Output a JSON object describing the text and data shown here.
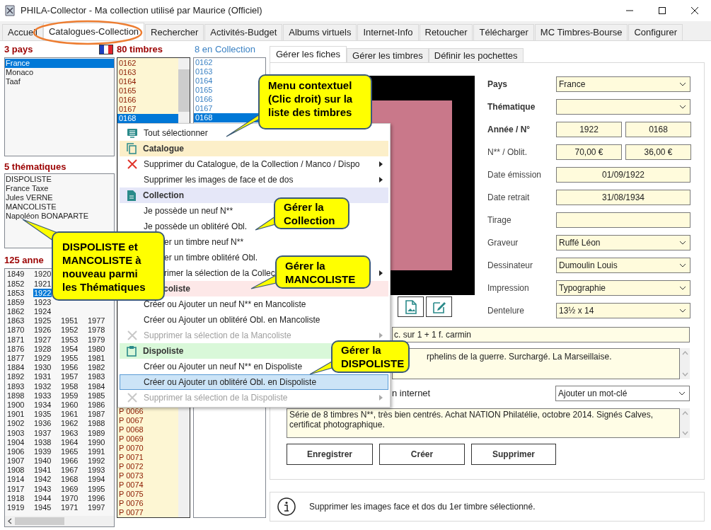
{
  "window": {
    "title": "PHILA-Collector - Ma collection utilisé par Maurice (Officiel)"
  },
  "tabs": [
    {
      "label": "Accueil",
      "selected": false
    },
    {
      "label": "Catalogues-Collection",
      "selected": true
    },
    {
      "label": "Rechercher",
      "selected": false
    },
    {
      "label": "Activités-Budget",
      "selected": false
    },
    {
      "label": "Albums virtuels",
      "selected": false
    },
    {
      "label": "Internet-Info",
      "selected": false
    },
    {
      "label": "Retoucher",
      "selected": false
    },
    {
      "label": "Télécharger",
      "selected": false
    },
    {
      "label": "MC Timbres-Bourse",
      "selected": false
    },
    {
      "label": "Configurer",
      "selected": false
    }
  ],
  "countries": {
    "heading": "3 pays",
    "items": [
      {
        "label": "France",
        "selected": true
      },
      {
        "label": "Monaco",
        "selected": false
      },
      {
        "label": "Taaf",
        "selected": false
      }
    ]
  },
  "themes": {
    "heading": "5 thématiques",
    "items": [
      "DISPOLISTE",
      "France Taxe",
      "Jules VERNE",
      "MANCOLISTE",
      "Napoléon BONAPARTE"
    ]
  },
  "years": {
    "heading": "125 anne",
    "columns": [
      [
        {
          "label": "1849",
          "selected": false
        },
        {
          "label": "1852",
          "selected": false
        },
        {
          "label": "1853",
          "selected": false
        },
        {
          "label": "1859",
          "selected": false
        },
        {
          "label": "1862",
          "selected": false
        },
        {
          "label": "1863",
          "selected": false
        },
        {
          "label": "1870",
          "selected": false
        },
        {
          "label": "1871",
          "selected": false
        },
        {
          "label": "1876",
          "selected": false
        },
        {
          "label": "1877",
          "selected": false
        },
        {
          "label": "1884",
          "selected": false
        },
        {
          "label": "1892",
          "selected": false
        },
        {
          "label": "1893",
          "selected": false
        },
        {
          "label": "1898",
          "selected": false
        },
        {
          "label": "1900",
          "selected": false
        },
        {
          "label": "1901",
          "selected": false
        },
        {
          "label": "1902",
          "selected": false
        },
        {
          "label": "1903",
          "selected": false
        },
        {
          "label": "1904",
          "selected": false
        },
        {
          "label": "1906",
          "selected": false
        },
        {
          "label": "1907",
          "selected": false
        },
        {
          "label": "1908",
          "selected": false
        },
        {
          "label": "1914",
          "selected": false
        },
        {
          "label": "1917",
          "selected": false
        },
        {
          "label": "1918",
          "selected": false
        },
        {
          "label": "1919",
          "selected": false
        }
      ],
      [
        {
          "label": "1920",
          "selected": false
        },
        {
          "label": "1921",
          "selected": false
        },
        {
          "label": "1922",
          "selected": true
        },
        {
          "label": "1923",
          "selected": false
        },
        {
          "label": "1924",
          "selected": false
        },
        {
          "label": "1925",
          "selected": false
        },
        {
          "label": "1926",
          "selected": false
        },
        {
          "label": "1927",
          "selected": false
        },
        {
          "label": "1928",
          "selected": false
        },
        {
          "label": "1929",
          "selected": false
        },
        {
          "label": "1930",
          "selected": false
        },
        {
          "label": "1931",
          "selected": false
        },
        {
          "label": "1932",
          "selected": false
        },
        {
          "label": "1933",
          "selected": false
        },
        {
          "label": "1934",
          "selected": false
        },
        {
          "label": "1935",
          "selected": false
        },
        {
          "label": "1936",
          "selected": false
        },
        {
          "label": "1937",
          "selected": false
        },
        {
          "label": "1938",
          "selected": false
        },
        {
          "label": "1939",
          "selected": false
        },
        {
          "label": "1940",
          "selected": false
        },
        {
          "label": "1941",
          "selected": false
        },
        {
          "label": "1942",
          "selected": false
        },
        {
          "label": "1943",
          "selected": false
        },
        {
          "label": "1944",
          "selected": false
        },
        {
          "label": "1945",
          "selected": false
        }
      ],
      [
        {
          "label": "1951",
          "selected": false
        },
        {
          "label": "1952",
          "selected": false
        },
        {
          "label": "1953",
          "selected": false
        },
        {
          "label": "1954",
          "selected": false
        },
        {
          "label": "1955",
          "selected": false
        },
        {
          "label": "1956",
          "selected": false
        },
        {
          "label": "1957",
          "selected": false
        },
        {
          "label": "1958",
          "selected": false
        },
        {
          "label": "1959",
          "selected": false
        },
        {
          "label": "1960",
          "selected": false
        },
        {
          "label": "1961",
          "selected": false
        },
        {
          "label": "1962",
          "selected": false
        },
        {
          "label": "1963",
          "selected": false
        },
        {
          "label": "1964",
          "selected": false
        },
        {
          "label": "1965",
          "selected": false
        },
        {
          "label": "1966",
          "selected": false
        },
        {
          "label": "1967",
          "selected": false
        },
        {
          "label": "1968",
          "selected": false
        },
        {
          "label": "1969",
          "selected": false
        },
        {
          "label": "1970",
          "selected": false
        },
        {
          "label": "1971",
          "selected": false
        }
      ],
      [
        {
          "label": "1977",
          "selected": false
        },
        {
          "label": "1978",
          "selected": false
        },
        {
          "label": "1979",
          "selected": false
        },
        {
          "label": "1980",
          "selected": false
        },
        {
          "label": "1981",
          "selected": false
        },
        {
          "label": "1982",
          "selected": false
        },
        {
          "label": "1983",
          "selected": false
        },
        {
          "label": "1984",
          "selected": false
        },
        {
          "label": "1985",
          "selected": false
        },
        {
          "label": "1986",
          "selected": false
        },
        {
          "label": "1987",
          "selected": false
        },
        {
          "label": "1988",
          "selected": false
        },
        {
          "label": "1989",
          "selected": false
        },
        {
          "label": "1990",
          "selected": false
        },
        {
          "label": "1991",
          "selected": false
        },
        {
          "label": "1992",
          "selected": false
        },
        {
          "label": "1993",
          "selected": false
        },
        {
          "label": "1994",
          "selected": false
        },
        {
          "label": "1995",
          "selected": false
        },
        {
          "label": "1996",
          "selected": false
        },
        {
          "label": "1997",
          "selected": false
        }
      ]
    ]
  },
  "stamps": {
    "heading": "80 timbres",
    "upper": [
      {
        "label": "0162",
        "selected": false
      },
      {
        "label": "0163",
        "selected": false
      },
      {
        "label": "0164",
        "selected": false
      },
      {
        "label": "0165",
        "selected": false
      },
      {
        "label": "0166",
        "selected": false
      },
      {
        "label": "0167",
        "selected": false
      },
      {
        "label": "0168",
        "selected": true
      }
    ],
    "lower": [
      "P 0066",
      "P 0067",
      "P 0068",
      "P 0069",
      "P 0070",
      "P 0071",
      "P 0072",
      "P 0073",
      "P 0074",
      "P 0075",
      "P 0076",
      "P 0077"
    ]
  },
  "collection": {
    "heading": "8 en Collection",
    "items": [
      {
        "label": "0162",
        "selected": false
      },
      {
        "label": "0163",
        "selected": false
      },
      {
        "label": "0164",
        "selected": false
      },
      {
        "label": "0165",
        "selected": false
      },
      {
        "label": "0166",
        "selected": false
      },
      {
        "label": "0167",
        "selected": false
      },
      {
        "label": "0168",
        "selected": true
      }
    ]
  },
  "context_menu": {
    "items": [
      {
        "kind": "item",
        "label": "Tout sélectionner",
        "submenu": false,
        "disabled": false,
        "selected": false
      },
      {
        "kind": "header",
        "label": "Catalogue",
        "color": "#fcefc9"
      },
      {
        "kind": "item",
        "label": "Supprimer du Catalogue, de la Collection / Manco / Dispo",
        "submenu": true,
        "disabled": false,
        "selected": false
      },
      {
        "kind": "item",
        "label": "Supprimer les images de face et de dos",
        "submenu": true,
        "disabled": false,
        "selected": false
      },
      {
        "kind": "header",
        "label": "Collection",
        "color": "#e5e7f8"
      },
      {
        "kind": "item",
        "label": "Je possède un neuf N**",
        "submenu": false,
        "disabled": false,
        "selected": false
      },
      {
        "kind": "item",
        "label": "Je possède un oblitéré Obl.",
        "submenu": false,
        "disabled": false,
        "selected": false
      },
      {
        "kind": "item",
        "label": "er un timbre neuf N**",
        "submenu": false,
        "disabled": false,
        "selected": false
      },
      {
        "kind": "item",
        "label": "er un timbre oblitéré Obl.",
        "submenu": false,
        "disabled": false,
        "selected": false
      },
      {
        "kind": "item",
        "label": "rimer la sélection de la Collec",
        "submenu": true,
        "disabled": false,
        "selected": false
      },
      {
        "kind": "header",
        "label": "coliste",
        "color": "#fde8e8"
      },
      {
        "kind": "item",
        "label": "Créer ou Ajouter un neuf N** en Mancoliste",
        "submenu": false,
        "disabled": false,
        "selected": false
      },
      {
        "kind": "item",
        "label": "Créer ou Ajouter un oblitéré Obl. en Mancoliste",
        "submenu": false,
        "disabled": false,
        "selected": false
      },
      {
        "kind": "item",
        "label": "Supprimer la sélection de la Mancoliste",
        "submenu": true,
        "disabled": true,
        "selected": false
      },
      {
        "kind": "header",
        "label": "Dispoliste",
        "color": "#d9f8d9"
      },
      {
        "kind": "item",
        "label": "Créer ou Ajouter un neuf N** en Dispoliste",
        "submenu": false,
        "disabled": false,
        "selected": false
      },
      {
        "kind": "item",
        "label": "Créer ou Ajouter un oblitéré Obl. en Dispoliste",
        "submenu": false,
        "disabled": false,
        "selected": true
      },
      {
        "kind": "item",
        "label": "Supprimer la sélection de la Dispoliste",
        "submenu": true,
        "disabled": true,
        "selected": false
      }
    ]
  },
  "subtabs": [
    {
      "label": "Gérer les fiches",
      "selected": true
    },
    {
      "label": "Gérer les timbres",
      "selected": false
    },
    {
      "label": "Définir les pochettes",
      "selected": false
    }
  ],
  "form": {
    "fields": [
      {
        "label": "Pays",
        "bold": true,
        "kind": "select",
        "values": [
          "France"
        ]
      },
      {
        "label": "Thématique",
        "bold": true,
        "kind": "select"
      },
      {
        "label": "Année / N°",
        "bold": true,
        "kind": "pair",
        "values": [
          "1922",
          "0168"
        ]
      },
      {
        "label": "N** / Oblit.",
        "bold": false,
        "kind": "pair",
        "values": [
          "70,00 €",
          "36,00 €"
        ]
      },
      {
        "label": "Date émission",
        "bold": false,
        "kind": "text",
        "values": [
          "01/09/1922"
        ]
      },
      {
        "label": "Date retrait",
        "bold": false,
        "kind": "text",
        "values": [
          "31/08/1934"
        ]
      },
      {
        "label": "Tirage",
        "bold": false,
        "kind": "text"
      },
      {
        "label": "Graveur",
        "bold": false,
        "kind": "select",
        "values": [
          "Ruffé Léon"
        ]
      },
      {
        "label": "Dessinateur",
        "bold": false,
        "kind": "select",
        "values": [
          "Dumoulin Louis"
        ]
      },
      {
        "label": "Impression",
        "bold": false,
        "kind": "select",
        "values": [
          "Typographie"
        ]
      },
      {
        "label": "Dentelure",
        "bold": false,
        "kind": "select",
        "values": [
          "13½ x 14"
        ]
      }
    ]
  },
  "details": {
    "title": "c. sur 1 + 1 f. carmin",
    "notes": "rphelins de la guerre. Surchargé. La Marseillaise.",
    "internet_label": "n internet",
    "keyword_select": "Ajouter un mot-clé",
    "comment": "Série de 8 timbres N**, très bien centrés. Achat NATION Philatélie, octobre 2014. Signés Calves, certificat photographique."
  },
  "buttons": [
    "Enregistrer",
    "Créer",
    "Supprimer"
  ],
  "status": {
    "message": "Supprimer les images face et dos du 1er timbre sélectionné."
  },
  "callouts": [
    "Menu contextuel (Clic droit) sur la liste des timbres",
    "DISPOLISTE et MANCOLISTE à nouveau parmi les Thématiques",
    "Gérer la Collection",
    "Gérer la MANCOLISTE",
    "Gérer la DISPOLISTE"
  ]
}
